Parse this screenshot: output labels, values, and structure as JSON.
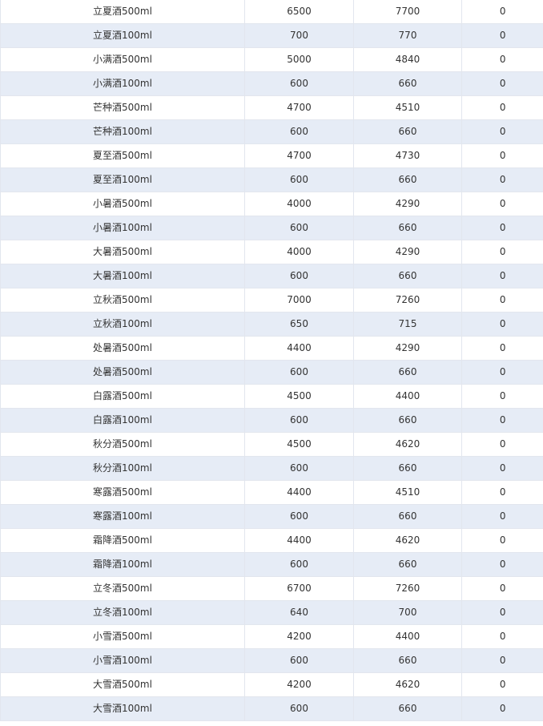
{
  "table": {
    "rows": [
      [
        "立夏酒500ml",
        "6500",
        "7700",
        "0"
      ],
      [
        "立夏酒100ml",
        "700",
        "770",
        "0"
      ],
      [
        "小满酒500ml",
        "5000",
        "4840",
        "0"
      ],
      [
        "小满酒100ml",
        "600",
        "660",
        "0"
      ],
      [
        "芒种酒500ml",
        "4700",
        "4510",
        "0"
      ],
      [
        "芒种酒100ml",
        "600",
        "660",
        "0"
      ],
      [
        "夏至酒500ml",
        "4700",
        "4730",
        "0"
      ],
      [
        "夏至酒100ml",
        "600",
        "660",
        "0"
      ],
      [
        "小暑酒500ml",
        "4000",
        "4290",
        "0"
      ],
      [
        "小暑酒100ml",
        "600",
        "660",
        "0"
      ],
      [
        "大暑酒500ml",
        "4000",
        "4290",
        "0"
      ],
      [
        "大暑酒100ml",
        "600",
        "660",
        "0"
      ],
      [
        "立秋酒500ml",
        "7000",
        "7260",
        "0"
      ],
      [
        "立秋酒100ml",
        "650",
        "715",
        "0"
      ],
      [
        "处暑酒500ml",
        "4400",
        "4290",
        "0"
      ],
      [
        "处暑酒500ml",
        "600",
        "660",
        "0"
      ],
      [
        "白露酒500ml",
        "4500",
        "4400",
        "0"
      ],
      [
        "白露酒100ml",
        "600",
        "660",
        "0"
      ],
      [
        "秋分酒500ml",
        "4500",
        "4620",
        "0"
      ],
      [
        "秋分酒100ml",
        "600",
        "660",
        "0"
      ],
      [
        "寒露酒500ml",
        "4400",
        "4510",
        "0"
      ],
      [
        "寒露酒100ml",
        "600",
        "660",
        "0"
      ],
      [
        "霜降酒500ml",
        "4400",
        "4620",
        "0"
      ],
      [
        "霜降酒100ml",
        "600",
        "660",
        "0"
      ],
      [
        "立冬酒500ml",
        "6700",
        "7260",
        "0"
      ],
      [
        "立冬酒100ml",
        "640",
        "700",
        "0"
      ],
      [
        "小雪酒500ml",
        "4200",
        "4400",
        "0"
      ],
      [
        "小雪酒100ml",
        "600",
        "660",
        "0"
      ],
      [
        "大雪酒500ml",
        "4200",
        "4620",
        "0"
      ],
      [
        "大雪酒100ml",
        "600",
        "660",
        "0"
      ]
    ]
  },
  "colors": {
    "row_alt_background": "#e6ecf6",
    "row_background": "#ffffff",
    "grid_line": "#e2e6ee",
    "text": "#333333"
  }
}
